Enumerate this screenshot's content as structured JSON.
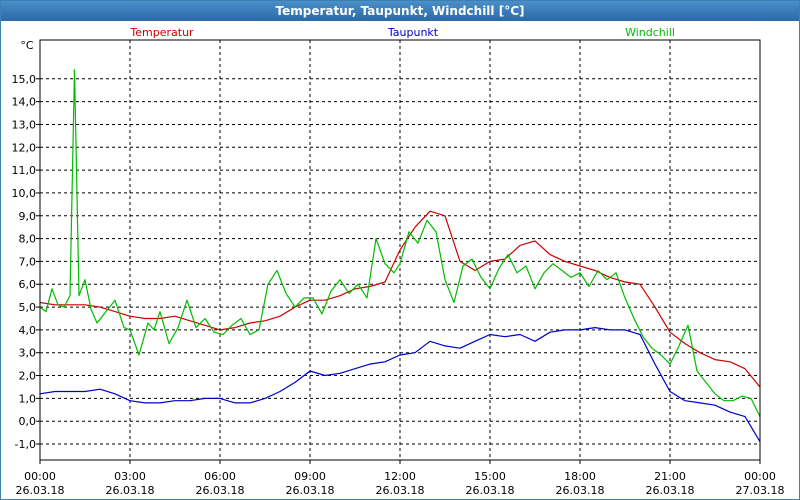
{
  "window": {
    "title": "Temperatur, Taupunkt, Windchill [°C]"
  },
  "chart_data": {
    "type": "line",
    "title": "Temperatur, Taupunkt, Windchill [°C]",
    "ylabel": "°C",
    "ylim": [
      -1.7,
      16.7
    ],
    "yticks": [
      "15,0",
      "14,0",
      "13,0",
      "12,0",
      "11,0",
      "10,0",
      "9,0",
      "8,0",
      "7,0",
      "6,0",
      "5,0",
      "4,0",
      "3,0",
      "2,0",
      "1,0",
      "0,0",
      "-1,0"
    ],
    "ytick_values": [
      15,
      14,
      13,
      12,
      11,
      10,
      9,
      8,
      7,
      6,
      5,
      4,
      3,
      2,
      1,
      0,
      -1
    ],
    "xlim": [
      0,
      24
    ],
    "xtick_values": [
      0,
      3,
      6,
      9,
      12,
      15,
      18,
      21,
      24
    ],
    "xtick_time": [
      "00:00",
      "03:00",
      "06:00",
      "09:00",
      "12:00",
      "15:00",
      "18:00",
      "21:00",
      "00:00"
    ],
    "xtick_date": [
      "26.03.18",
      "26.03.18",
      "26.03.18",
      "26.03.18",
      "26.03.18",
      "26.03.18",
      "26.03.18",
      "26.03.18",
      "27.03.18"
    ],
    "grid": true,
    "legend_position": "top",
    "colors": {
      "Temperatur": "#cc0000",
      "Taupunkt": "#0000cc",
      "Windchill": "#00bb00"
    },
    "series": [
      {
        "name": "Temperatur",
        "x": [
          0,
          0.5,
          1,
          1.5,
          2,
          2.5,
          3,
          3.5,
          4,
          4.5,
          5,
          5.5,
          6,
          6.5,
          7,
          7.5,
          8,
          8.5,
          9,
          9.5,
          10,
          10.5,
          11,
          11.5,
          12,
          12.5,
          13,
          13.5,
          14,
          14.5,
          15,
          15.5,
          16,
          16.5,
          17,
          17.5,
          18,
          18.5,
          19,
          19.5,
          20,
          20.5,
          21,
          21.5,
          22,
          22.5,
          23,
          23.5,
          24
        ],
        "values": [
          5.2,
          5.1,
          5.1,
          5.1,
          5.0,
          4.8,
          4.6,
          4.5,
          4.5,
          4.6,
          4.4,
          4.2,
          4.0,
          4.1,
          4.3,
          4.4,
          4.6,
          5.0,
          5.3,
          5.3,
          5.5,
          5.8,
          5.9,
          6.1,
          7.5,
          8.5,
          9.2,
          9.0,
          7.0,
          6.6,
          7.0,
          7.1,
          7.7,
          7.9,
          7.3,
          7.0,
          6.8,
          6.6,
          6.3,
          6.1,
          6.0,
          5.0,
          3.9,
          3.4,
          3.0,
          2.7,
          2.6,
          2.3,
          1.5
        ]
      },
      {
        "name": "Taupunkt",
        "x": [
          0,
          0.5,
          1,
          1.5,
          2,
          2.5,
          3,
          3.5,
          4,
          4.5,
          5,
          5.5,
          6,
          6.5,
          7,
          7.5,
          8,
          8.5,
          9,
          9.5,
          10,
          10.5,
          11,
          11.5,
          12,
          12.5,
          13,
          13.5,
          14,
          14.5,
          15,
          15.5,
          16,
          16.5,
          17,
          17.5,
          18,
          18.5,
          19,
          19.5,
          20,
          20.5,
          21,
          21.5,
          22,
          22.5,
          23,
          23.5,
          24
        ],
        "values": [
          1.2,
          1.3,
          1.3,
          1.3,
          1.4,
          1.2,
          0.9,
          0.8,
          0.8,
          0.9,
          0.9,
          1.0,
          1.0,
          0.8,
          0.8,
          1.0,
          1.3,
          1.7,
          2.2,
          2.0,
          2.1,
          2.3,
          2.5,
          2.6,
          2.9,
          3.0,
          3.5,
          3.3,
          3.2,
          3.5,
          3.8,
          3.7,
          3.8,
          3.5,
          3.9,
          4.0,
          4.0,
          4.1,
          4.0,
          4.0,
          3.8,
          2.5,
          1.3,
          0.9,
          0.8,
          0.7,
          0.4,
          0.2,
          -0.9
        ]
      },
      {
        "name": "Windchill",
        "x": [
          0,
          0.2,
          0.4,
          0.6,
          0.8,
          1.0,
          1.15,
          1.3,
          1.5,
          1.7,
          1.9,
          2.2,
          2.5,
          2.8,
          3.0,
          3.3,
          3.6,
          3.8,
          4.0,
          4.3,
          4.6,
          4.9,
          5.2,
          5.5,
          5.8,
          6.1,
          6.4,
          6.7,
          7.0,
          7.3,
          7.6,
          7.9,
          8.2,
          8.5,
          8.8,
          9.1,
          9.4,
          9.7,
          10.0,
          10.3,
          10.6,
          10.9,
          11.2,
          11.5,
          11.8,
          12.0,
          12.3,
          12.6,
          12.9,
          13.2,
          13.5,
          13.8,
          14.1,
          14.4,
          14.7,
          15.0,
          15.3,
          15.6,
          15.9,
          16.2,
          16.5,
          16.8,
          17.1,
          17.4,
          17.7,
          18.0,
          18.3,
          18.6,
          18.9,
          19.2,
          19.5,
          19.8,
          20.1,
          20.4,
          20.7,
          21.0,
          21.3,
          21.6,
          21.9,
          22.2,
          22.5,
          22.8,
          23.1,
          23.4,
          23.7,
          24.0
        ],
        "values": [
          5.0,
          4.8,
          5.8,
          5.1,
          5.0,
          5.5,
          15.4,
          5.5,
          6.2,
          4.9,
          4.3,
          4.8,
          5.3,
          4.1,
          4.0,
          2.9,
          4.3,
          4.0,
          4.8,
          3.4,
          4.1,
          5.3,
          4.1,
          4.5,
          3.9,
          3.8,
          4.2,
          4.5,
          3.8,
          4.0,
          6.0,
          6.6,
          5.6,
          5.0,
          5.4,
          5.4,
          4.7,
          5.7,
          6.2,
          5.6,
          6.0,
          5.4,
          8.0,
          6.9,
          6.5,
          6.9,
          8.3,
          7.8,
          8.8,
          8.3,
          6.2,
          5.2,
          6.8,
          7.1,
          6.3,
          5.8,
          6.7,
          7.3,
          6.5,
          6.8,
          5.8,
          6.5,
          6.9,
          6.6,
          6.3,
          6.5,
          5.9,
          6.6,
          6.2,
          6.5,
          5.4,
          4.5,
          3.7,
          3.2,
          2.9,
          2.5,
          3.3,
          4.2,
          2.2,
          1.7,
          1.2,
          0.9,
          0.9,
          1.1,
          1.0,
          0.2
        ]
      }
    ]
  }
}
